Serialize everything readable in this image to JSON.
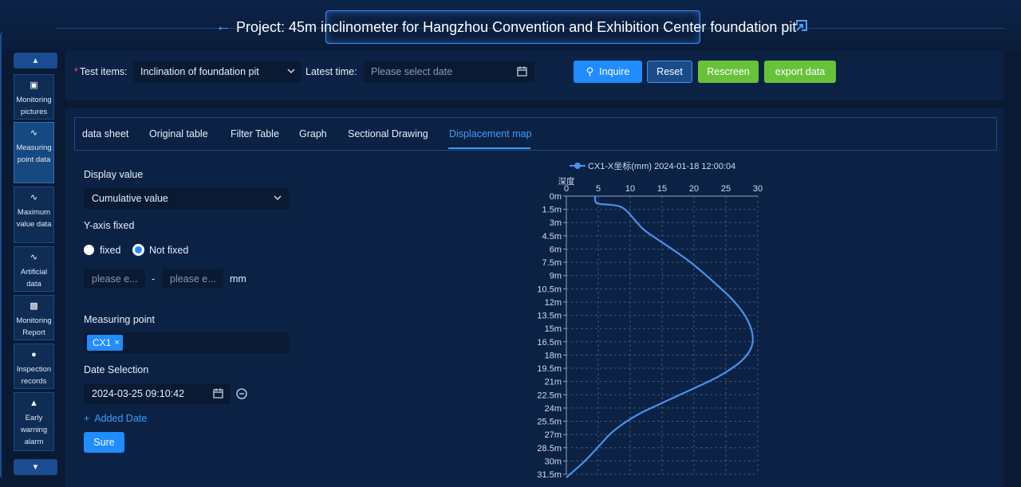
{
  "header": {
    "title": "Project: 45m inclinometer for Hangzhou Convention and Exhibition Center foundation pit"
  },
  "sidebar": {
    "items": [
      {
        "label": "Monitoring pictures",
        "icon": "image-icon"
      },
      {
        "label": "Measuring point data",
        "icon": "pulse-icon"
      },
      {
        "label": "Maximum value data",
        "icon": "pulse-icon"
      },
      {
        "label": "Artificial data",
        "icon": "pulse-icon"
      },
      {
        "label": "Monitoring Report",
        "icon": "clipboard-icon"
      },
      {
        "label": "Inspection records",
        "icon": "user-gear-icon"
      },
      {
        "label": "Early warning alarm",
        "icon": "alarm-icon"
      }
    ]
  },
  "toolbar": {
    "test_items_label": "Test items",
    "test_items_value": "Inclination of foundation pit",
    "latest_time_label": "Latest time",
    "latest_time_placeholder": "Please select date",
    "inquire_label": "Inquire",
    "reset_label": "Reset",
    "rescreen_label": "Rescreen",
    "export_label": "export data"
  },
  "tabs": [
    "data sheet",
    "Original table",
    "Filter Table",
    "Graph",
    "Sectional Drawing",
    "Displacement map"
  ],
  "active_tab": "Displacement map",
  "form": {
    "display_value_label": "Display value",
    "display_value": "Cumulative value",
    "y_axis_label": "Y-axis fixed",
    "radio_fixed": "fixed",
    "radio_not_fixed": "Not fixed",
    "radio_selected": "Not fixed",
    "range_min_placeholder": "please e...",
    "range_max_placeholder": "please e...",
    "range_separator": "-",
    "range_unit": "mm",
    "measuring_point_label": "Measuring point",
    "measuring_point_tag": "CX1",
    "date_selection_label": "Date Selection",
    "date_value": "2024-03-25 09:10:42",
    "added_date_label": "Added Date",
    "sure_label": "Sure"
  },
  "colors": {
    "accent": "#3f9bff",
    "button_blue": "#1f8cff",
    "button_green": "#67c23a",
    "series": "#4a90ee"
  },
  "chart_data": {
    "type": "line",
    "legend": [
      "CX1-X坐标(mm) 2024-01-18 12:00:04"
    ],
    "ylabel": "深度",
    "x_axis_position": "top",
    "xlim": [
      0,
      30
    ],
    "x_ticks": [
      "0",
      "5",
      "10",
      "15",
      "20",
      "25",
      "30"
    ],
    "y_ticks": [
      "0m",
      "1.5m",
      "3m",
      "4.5m",
      "6m",
      "7.5m",
      "9m",
      "10.5m",
      "12m",
      "13.5m",
      "15m",
      "16.5m",
      "18m",
      "19.5m",
      "21m",
      "22.5m",
      "24m",
      "25.5m",
      "27m",
      "28.5m",
      "30m",
      "31.5m"
    ],
    "series": [
      {
        "name": "CX1-X坐标(mm) 2024-01-18 12:00:04",
        "points": [
          [
            4.5,
            0.0
          ],
          [
            4.5,
            0.6
          ],
          [
            4.8,
            0.9
          ],
          [
            7.5,
            1.0
          ],
          [
            9.0,
            1.3
          ],
          [
            10.5,
            2.5
          ],
          [
            12.0,
            3.8
          ],
          [
            14.5,
            5.0
          ],
          [
            17.0,
            6.2
          ],
          [
            19.5,
            7.5
          ],
          [
            21.5,
            8.7
          ],
          [
            23.5,
            10.0
          ],
          [
            25.5,
            11.3
          ],
          [
            27.0,
            12.5
          ],
          [
            28.2,
            13.7
          ],
          [
            29.0,
            15.0
          ],
          [
            29.3,
            16.2
          ],
          [
            29.0,
            17.3
          ],
          [
            27.8,
            18.5
          ],
          [
            26.0,
            19.5
          ],
          [
            23.5,
            20.6
          ],
          [
            20.5,
            21.6
          ],
          [
            17.5,
            22.6
          ],
          [
            14.5,
            23.6
          ],
          [
            11.5,
            24.6
          ],
          [
            9.0,
            25.7
          ],
          [
            7.0,
            26.8
          ],
          [
            5.5,
            28.0
          ],
          [
            4.0,
            29.2
          ],
          [
            2.5,
            30.3
          ],
          [
            0.0,
            32.0
          ]
        ]
      }
    ],
    "grid": true
  }
}
